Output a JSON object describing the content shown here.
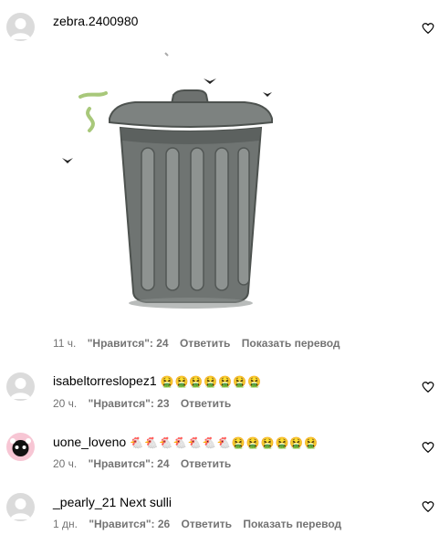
{
  "comments": [
    {
      "username": "zebra.2400980",
      "text": "",
      "time": "11 ч.",
      "likes": "\"Нравится\": 24",
      "reply": "Ответить",
      "translate": "Показать перевод"
    },
    {
      "username": "isabeltorreslopez1",
      "text": "🤮🤮🤮🤮🤮🤮🤮",
      "time": "20 ч.",
      "likes": "\"Нравится\": 23",
      "reply": "Ответить"
    },
    {
      "username": "uone_loveno",
      "text": "🐔🐔🐔🐔🐔🐔🐔🤮🤮🤮🤮🤮🤮",
      "time": "20 ч.",
      "likes": "\"Нравится\": 24",
      "reply": "Ответить"
    },
    {
      "username": "_pearly_21",
      "text": "Next sulli",
      "time": "1 дн.",
      "likes": "\"Нравится\": 26",
      "reply": "Ответить",
      "translate": "Показать перевод"
    }
  ],
  "icons": {
    "like": "heart-outline-icon",
    "avatar": "default-avatar-icon"
  },
  "colors": {
    "meta": "#737373",
    "avatar_bg": "#dbdbdb"
  }
}
